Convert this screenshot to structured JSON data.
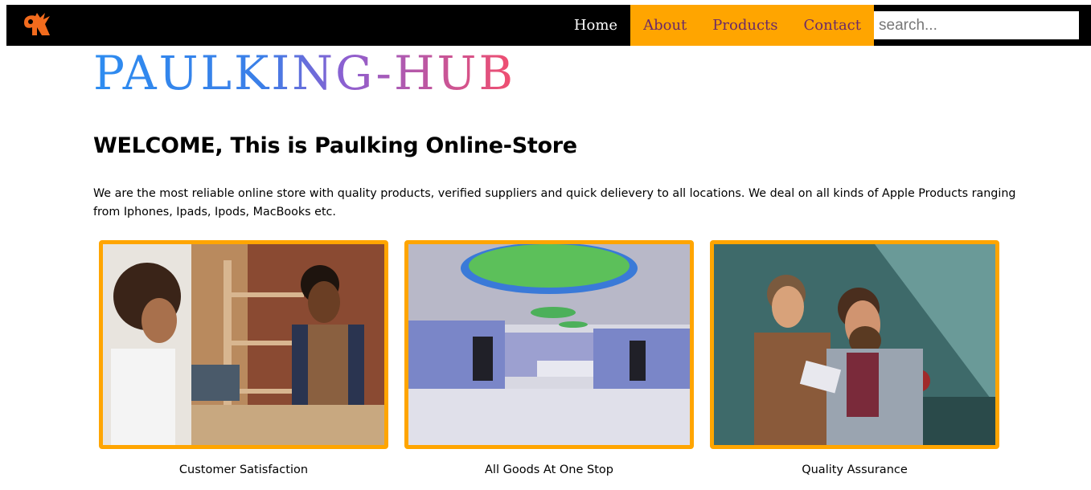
{
  "nav": {
    "logo": "paulking-logo-icon",
    "items": [
      {
        "label": "Home"
      },
      {
        "label": "About"
      },
      {
        "label": "Products"
      },
      {
        "label": "Contact"
      }
    ],
    "search_placeholder": "search..."
  },
  "brand": "PAULKING-HUB",
  "welcome": "WELCOME, This is Paulking Online-Store",
  "intro": "We are the most reliable online store with quality products, verified suppliers and quick delievery to all locations. We deal on all kinds of Apple Products ranging from Iphones, Ipads, Ipods, MacBooks etc.",
  "cards": [
    {
      "caption": "Customer Satisfaction",
      "image": "shop-counter-photo"
    },
    {
      "caption": "All Goods At One Stop",
      "image": "store-interior-photo"
    },
    {
      "caption": "Quality Assurance",
      "image": "men-with-tablet-photo"
    }
  ],
  "colors": {
    "accent": "#ffa500",
    "navbar": "#000000"
  }
}
